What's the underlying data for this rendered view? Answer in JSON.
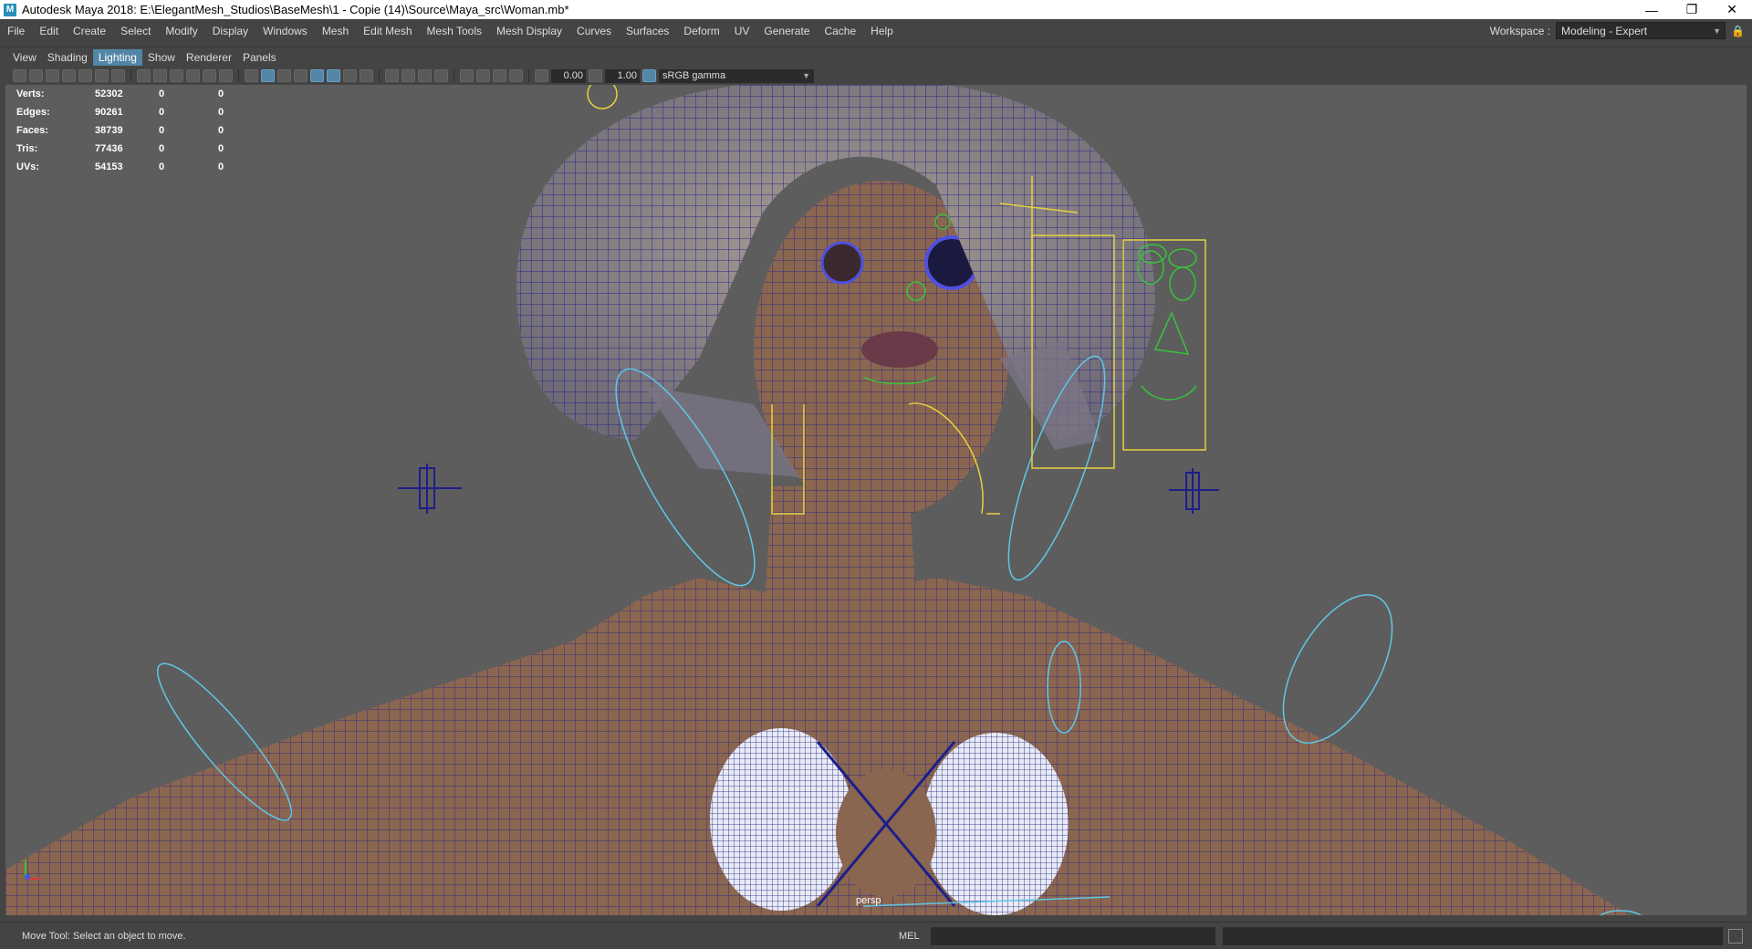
{
  "titlebar": {
    "title": "Autodesk Maya 2018: E:\\ElegantMesh_Studios\\BaseMesh\\1 - Copie (14)\\Source\\Maya_src\\Woman.mb*",
    "app_icon_letter": "M"
  },
  "menubar": {
    "items": [
      "File",
      "Edit",
      "Create",
      "Select",
      "Modify",
      "Display",
      "Windows",
      "Mesh",
      "Edit Mesh",
      "Mesh Tools",
      "Mesh Display",
      "Curves",
      "Surfaces",
      "Deform",
      "UV",
      "Generate",
      "Cache",
      "Help"
    ]
  },
  "workspace": {
    "label": "Workspace :",
    "value": "Modeling - Expert"
  },
  "panel_menu": {
    "items": [
      "View",
      "Shading",
      "Lighting",
      "Show",
      "Renderer",
      "Panels"
    ],
    "active": "Lighting"
  },
  "toolbar": {
    "exposure": "0.00",
    "gamma": "1.00",
    "colorspace": "sRGB gamma"
  },
  "hud": {
    "rows": [
      {
        "label": "Verts:",
        "v1": "52302",
        "v2": "0",
        "v3": "0"
      },
      {
        "label": "Edges:",
        "v1": "90261",
        "v2": "0",
        "v3": "0"
      },
      {
        "label": "Faces:",
        "v1": "38739",
        "v2": "0",
        "v3": "0"
      },
      {
        "label": "Tris:",
        "v1": "77436",
        "v2": "0",
        "v3": "0"
      },
      {
        "label": "UVs:",
        "v1": "54153",
        "v2": "0",
        "v3": "0"
      }
    ]
  },
  "viewport": {
    "camera": "persp"
  },
  "statusbar": {
    "help_text": "Move Tool: Select an object to move.",
    "command_lang": "MEL"
  },
  "colors": {
    "accent": "#5285a6",
    "viewport_bg": "#5d5d5d",
    "skin": "#8a6650",
    "wire": "#1e1e8a",
    "ctrl_yellow": "#e6d23c",
    "ctrl_green": "#3ac23a",
    "ctrl_cyan": "#5fc7e6"
  }
}
